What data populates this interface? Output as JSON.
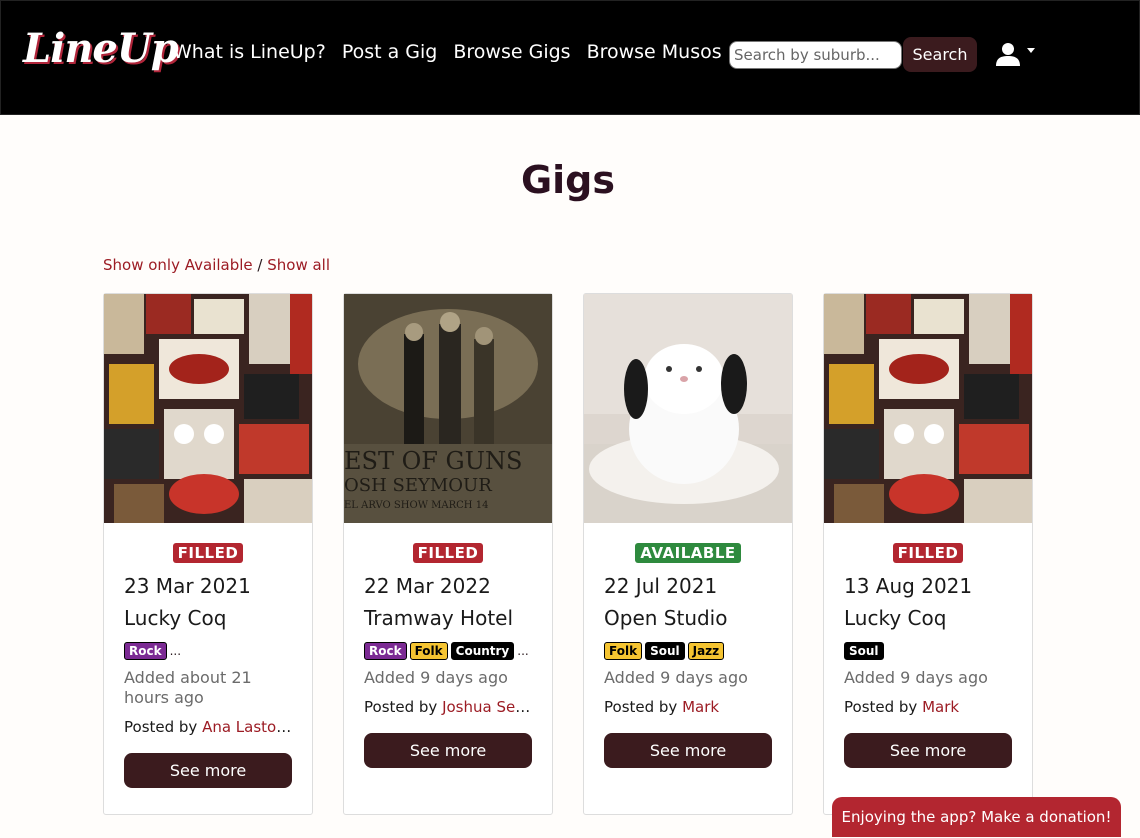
{
  "nav": {
    "brand": "LineUp",
    "links": [
      "What is LineUp?",
      "Post a Gig",
      "Browse Gigs",
      "Browse Musos"
    ],
    "search_placeholder": "Search by suburb...",
    "search_button": "Search",
    "user_icon": "user-icon"
  },
  "page": {
    "title": "Gigs",
    "filter_available": "Show only Available",
    "filter_separator": " / ",
    "filter_all": "Show all"
  },
  "colors": {
    "filled": "#b32630",
    "available": "#2e8a3e",
    "accent": "#3b1b1e",
    "link": "#9c1c24"
  },
  "cards": [
    {
      "image": "rock-posters-wall",
      "status": "FILLED",
      "date": "23 Mar 2021",
      "venue": "Lucky Coq",
      "tags": [
        "Rock"
      ],
      "tags_more": "...",
      "added": "Added about 21 hours ago",
      "posted_prefix": "Posted by ",
      "posted_by": "Ana Lastov...",
      "button": "See more"
    },
    {
      "image": "band-album-cover",
      "status": "FILLED",
      "date": "22 Mar 2022",
      "venue": "Tramway Hotel",
      "tags": [
        "Rock",
        "Folk",
        "Country"
      ],
      "tags_more": "...",
      "added": "Added 9 days ago",
      "posted_prefix": "Posted by ",
      "posted_by": "Joshua Sey...",
      "button": "See more"
    },
    {
      "image": "white-rabbit-photo",
      "status": "AVAILABLE",
      "date": "22 Jul 2021",
      "venue": "Open Studio",
      "tags": [
        "Folk",
        "Soul",
        "Jazz"
      ],
      "tags_more": "",
      "added": "Added 9 days ago",
      "posted_prefix": "Posted by ",
      "posted_by": "Mark",
      "button": "See more"
    },
    {
      "image": "rock-posters-wall",
      "status": "FILLED",
      "date": "13 Aug 2021",
      "venue": "Lucky Coq",
      "tags": [
        "Soul"
      ],
      "tags_more": "",
      "added": "Added 9 days ago",
      "posted_prefix": "Posted by ",
      "posted_by": "Mark",
      "button": "See more"
    }
  ],
  "donate_button": "Enjoying the app? Make a donation!"
}
